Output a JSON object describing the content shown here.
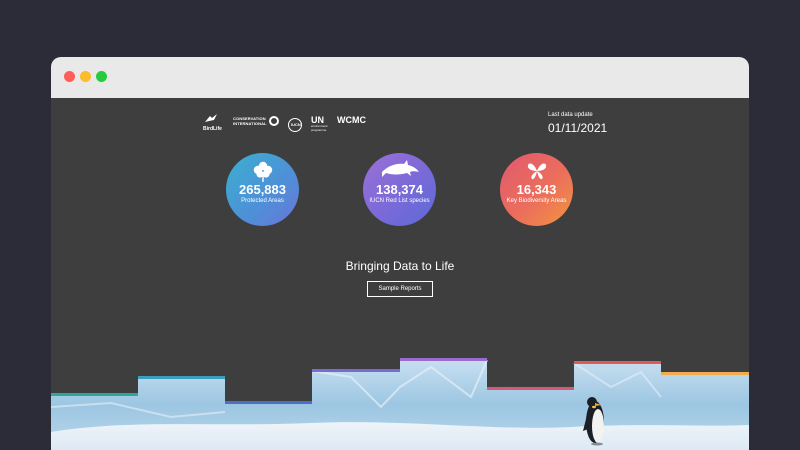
{
  "browser": {
    "controls": [
      "close",
      "minimize",
      "maximize"
    ]
  },
  "logos": {
    "birdlife": "BirdLife",
    "conservation": "CONSERVATION",
    "conservation_sub": "INTERNATIONAL",
    "iucn": "IUCN",
    "un": "UN",
    "un_sub1": "environment",
    "un_sub2": "programme",
    "wcmc": "WCMC"
  },
  "update": {
    "label": "Last data update",
    "date": "01/11/2021"
  },
  "stats": [
    {
      "value": "265,883",
      "label": "Protected Areas",
      "icon": "flower-icon"
    },
    {
      "value": "138,374",
      "label": "IUCN Red List species",
      "icon": "dolphin-icon"
    },
    {
      "value": "16,343",
      "label": "Key Biodiversity Areas",
      "icon": "butterfly-icon"
    }
  ],
  "hero": {
    "tagline": "Bringing Data to Life",
    "button_label": "Sample Reports"
  },
  "colors": {
    "background": "#3e3e3e",
    "step_colors": [
      "#2aa7a0",
      "#3a9fbf",
      "#4c70c4",
      "#7a6ad1",
      "#9a6bd1",
      "#d9587a",
      "#e2595b",
      "#f0ad4e"
    ]
  }
}
